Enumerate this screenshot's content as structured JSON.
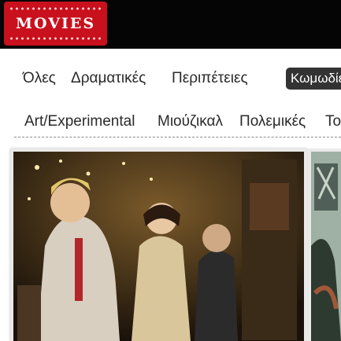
{
  "header": {
    "logo_text": "MOVIES",
    "logo_icon": "movies-logo-icon",
    "colors": {
      "bar": "#050505",
      "logo": "#c9101d"
    }
  },
  "filters": {
    "row1": [
      {
        "label": "Όλες",
        "active": false
      },
      {
        "label": "Δραματικές",
        "active": false
      },
      {
        "label": "Περιπέτειες",
        "active": false
      },
      {
        "label": "Κωμωδίες",
        "active": true
      }
    ],
    "row2": [
      {
        "label": "Art/Experimental",
        "active": false
      },
      {
        "label": "Μιούζικαλ",
        "active": false
      },
      {
        "label": "Πολεμικές",
        "active": false
      },
      {
        "label": "Το",
        "active": false
      }
    ],
    "active_color": "#333333"
  },
  "posters": {
    "main": {
      "icon": "movie-poster-image"
    },
    "side": {
      "icon": "movie-poster-image"
    }
  }
}
